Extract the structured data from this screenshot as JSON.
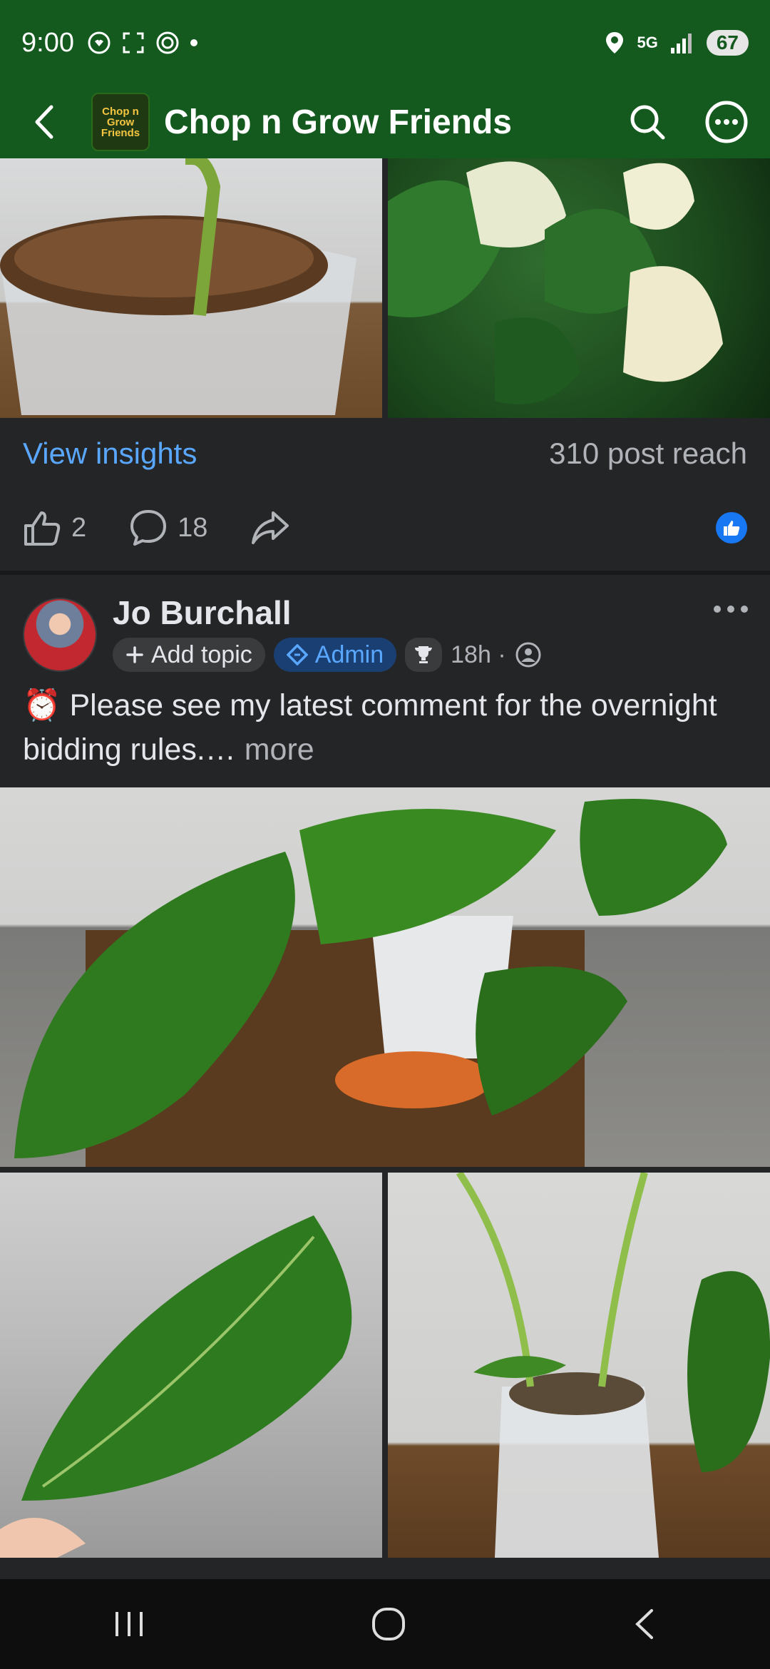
{
  "status_bar": {
    "time": "9:00",
    "battery": "67",
    "network": "5G"
  },
  "header": {
    "group_name": "Chop n Grow Friends",
    "logo_text": "Chop n Grow Friends"
  },
  "first_post": {
    "view_insights": "View insights",
    "post_reach": "310 post reach",
    "likes": "2",
    "comments": "18"
  },
  "second_post": {
    "author": "Jo Burchall",
    "add_topic": "Add topic",
    "admin_label": "Admin",
    "time": "18h ·",
    "text_emoji": "⏰",
    "text": "Please see my latest comment for the overnight bidding rules.…",
    "more_label": "more"
  },
  "colors": {
    "brand_green": "#145a1f",
    "link_blue": "#5aa7ff",
    "background": "#242527"
  }
}
